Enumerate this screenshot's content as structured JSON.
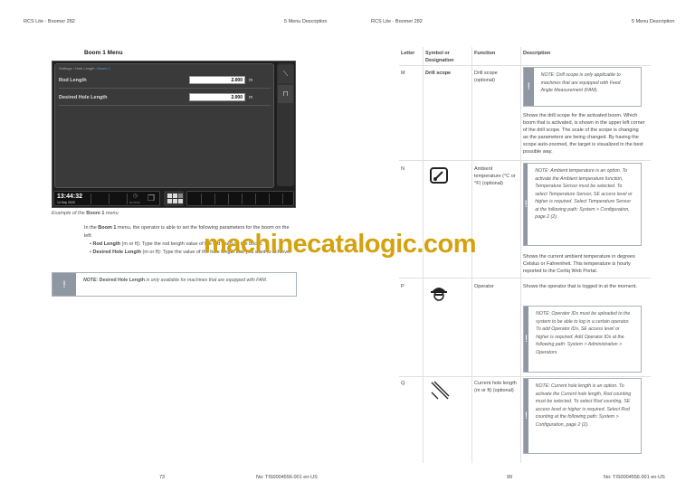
{
  "left_page": {
    "header_left": "RCS Lite - Boomer 282",
    "header_right": "5 Menu Description",
    "section_title": "Boom 1 Menu",
    "screen": {
      "breadcrumb": "Settings › Hole Length › ",
      "breadcrumb_active": "Boom 1",
      "fields": [
        {
          "label": "Rod Length",
          "value": "2.000",
          "unit": "m"
        },
        {
          "label": "Desired Hole Length",
          "value": "2.000",
          "unit": "m"
        }
      ],
      "time": "13:44:32",
      "date": "14 Sep 2020",
      "timer": "00:00:00"
    },
    "caption_pre": "Example of the ",
    "caption_bold": "Boom 1",
    "caption_post": " menu",
    "intro_pre": "In the ",
    "intro_bold": "Boom 1",
    "intro_post": " menu, the operator is able to set the following parameters for the boom on the left:",
    "bullets": [
      {
        "bold": "Rod Length",
        "text": " (m or ft): Type the rod length value of the rod used on the boom."
      },
      {
        "bold": "Desired Hole Length",
        "text": " (m or ft): Type the value of the hole length that you want to achieve."
      }
    ],
    "note": {
      "prefix": "NOTE: ",
      "bold": "Desired Hole Length",
      "text": " is only available for machines that are equipped with FAM."
    },
    "page_number": "73",
    "doc_number": "No: TIS0004556.001 en-US"
  },
  "right_page": {
    "header_left": "RCS Lite - Boomer 282",
    "header_right": "5 Menu Description",
    "columns": [
      "Letter",
      "Symbol or Designation",
      "Function",
      "Description"
    ],
    "rows": [
      {
        "letter": "M",
        "symbol": "Drill scope",
        "function": "Drill scope (optional)",
        "note": "NOTE: Drill scope is only applicable to machines that are equipped with Feed Angle Measurement (FAM).",
        "description": "Shows the drill scope for the activated boom. Which boom that is activated, is shown in the upper left corner of the drill scope. The scale of the scope is changing as the parameters are being changed. By having the scope auto-zoomed, the target is visualized in the best possible way."
      },
      {
        "letter": "N",
        "symbol": "",
        "function": "Ambient temperature (°C or °F) (optional)",
        "note": "NOTE: Ambient temperature is an option. To activate the Ambient temperature function, Temperature Sensor must be selected. To select Temperature Sensor, SE access level or higher is required. Select Temperature Sensor at the following path: System > Configuration, page 2 (2).",
        "description": "Shows the current ambient temperature in degrees Celsius or Fahrenheit. This temperature is hourly reported to the Certiq Web Portal."
      },
      {
        "letter": "P",
        "symbol": "",
        "function": "Operator",
        "note": "NOTE: Operator IDs must be uploaded to the system to be able to log in a certain operator. To add Operator IDs, SE access level or higher is required. Add Operator IDs at the following path: System > Administration > Operators.",
        "description": "Shows the operator that is logged in at the moment."
      },
      {
        "letter": "Q",
        "symbol": "",
        "function": "Current hole length (m or ft) (optional)",
        "note": "NOTE: Current hole length is an option. To activate the Current hole length, Rod counting must be selected. To select Rod counting, SE access level or higher is required. Select Rod counting at the following path: System > Configuration, page 2 (2).",
        "description": ""
      }
    ],
    "page_number": "99",
    "doc_number": "No: TIS0004556.001 en-US"
  },
  "watermark": "machinecatalogic.com"
}
